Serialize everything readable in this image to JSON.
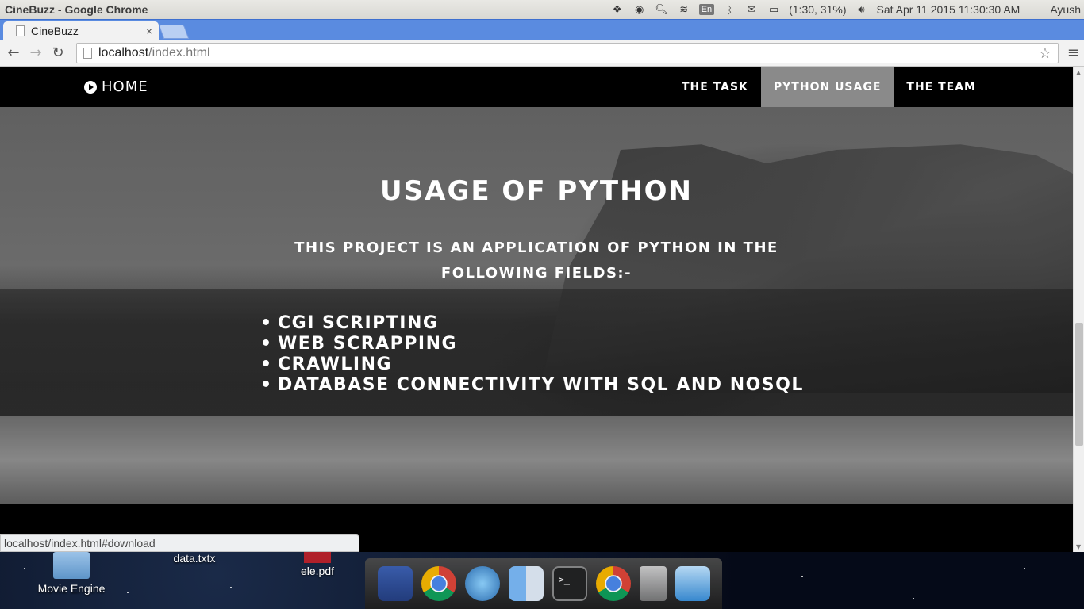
{
  "os": {
    "window_title": "CineBuzz - Google Chrome",
    "lang": "En",
    "battery": "(1:30, 31%)",
    "clock": "Sat Apr 11 2015 11:30:30 AM",
    "user": "Ayush"
  },
  "browser": {
    "tab_title": "CineBuzz",
    "tab_close": "×",
    "url_host": "localhost",
    "url_path": "/index.html",
    "status_text": "localhost/index.html#download"
  },
  "site": {
    "brand": "HOME",
    "nav": [
      {
        "label": "THE TASK",
        "active": false
      },
      {
        "label": "PYTHON USAGE",
        "active": true
      },
      {
        "label": "THE TEAM",
        "active": false
      }
    ]
  },
  "hero": {
    "title": "USAGE OF PYTHON",
    "subtitle": "THIS PROJECT IS AN APPLICATION OF PYTHON IN THE FOLLOWING FIELDS:-",
    "items": [
      "CGI SCRIPTING",
      "WEB SCRAPPING",
      "CRAWLING",
      "DATABASE CONNECTIVITY WITH SQL AND NOSQL"
    ]
  },
  "desktop": {
    "items": [
      {
        "label": "Movie Engine",
        "icon": "folder-icon"
      },
      {
        "label": "data.txtx",
        "icon": "text-file-icon"
      },
      {
        "label": "ele.pdf",
        "icon": "pdf-icon"
      }
    ],
    "dock": [
      "files-icon",
      "chrome-icon",
      "safari-icon",
      "finder-icon",
      "terminal-icon",
      "chrome-icon",
      "trash-icon",
      "desktop-folder-icon"
    ]
  }
}
